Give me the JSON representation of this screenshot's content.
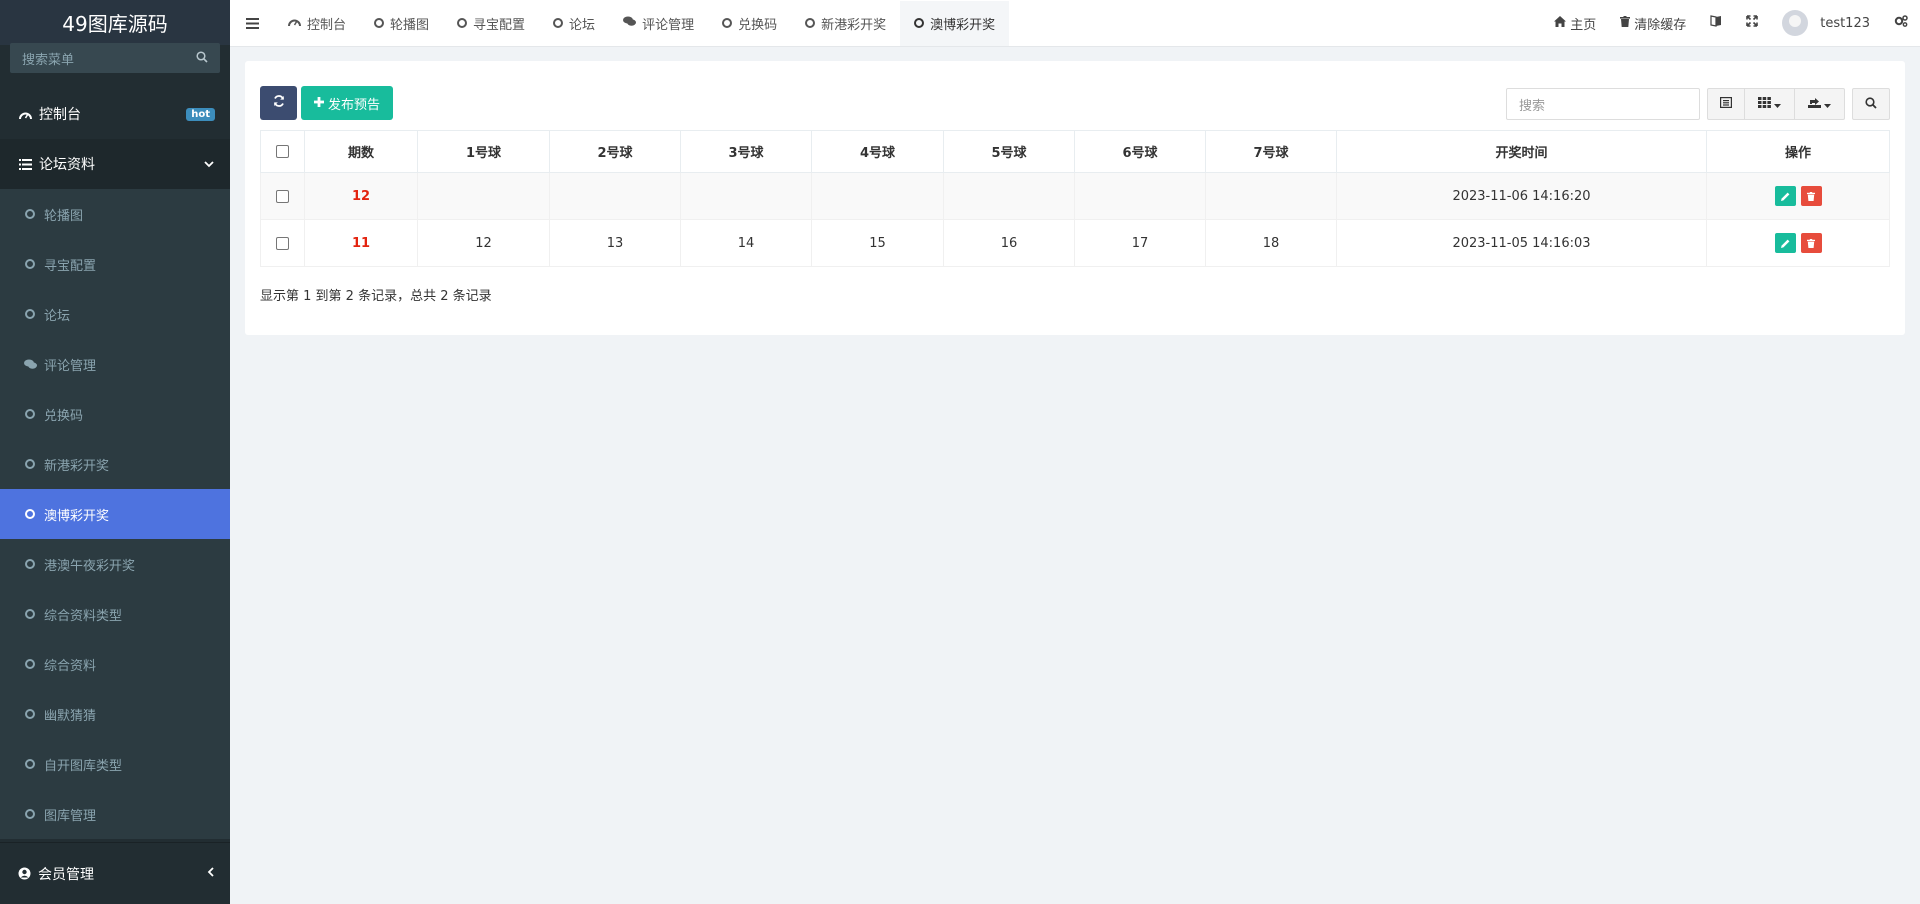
{
  "brand": "49图库源码",
  "sidebar": {
    "search_placeholder": "搜索菜单",
    "dashboard": {
      "label": "控制台",
      "badge": "hot"
    },
    "group": {
      "label": "论坛资料"
    },
    "items": [
      {
        "label": "轮播图"
      },
      {
        "label": "寻宝配置"
      },
      {
        "label": "论坛"
      },
      {
        "label": "评论管理"
      },
      {
        "label": "兑换码"
      },
      {
        "label": "新港彩开奖"
      },
      {
        "label": "澳博彩开奖"
      },
      {
        "label": "港澳午夜彩开奖"
      },
      {
        "label": "综合资料类型"
      },
      {
        "label": "综合资料"
      },
      {
        "label": "幽默猜猜"
      },
      {
        "label": "自开图库类型"
      },
      {
        "label": "图库管理"
      }
    ],
    "member": {
      "label": "会员管理"
    }
  },
  "topbar": {
    "tabs": [
      {
        "label": "控制台"
      },
      {
        "label": "轮播图"
      },
      {
        "label": "寻宝配置"
      },
      {
        "label": "论坛"
      },
      {
        "label": "评论管理"
      },
      {
        "label": "兑换码"
      },
      {
        "label": "新港彩开奖"
      },
      {
        "label": "澳博彩开奖"
      }
    ],
    "home": "主页",
    "clear_cache": "清除缓存",
    "username": "test123"
  },
  "toolbar": {
    "add_label": "发布预告",
    "search_placeholder": "搜索"
  },
  "table": {
    "headers": [
      "期数",
      "1号球",
      "2号球",
      "3号球",
      "4号球",
      "5号球",
      "6号球",
      "7号球",
      "开奖时间",
      "操作"
    ],
    "rows": [
      {
        "issue": "12",
        "b1": "",
        "b2": "",
        "b3": "",
        "b4": "",
        "b5": "",
        "b6": "",
        "b7": "",
        "time": "2023-11-06 14:16:20"
      },
      {
        "issue": "11",
        "b1": "12",
        "b2": "13",
        "b3": "14",
        "b4": "15",
        "b5": "16",
        "b6": "17",
        "b7": "18",
        "time": "2023-11-05 14:16:03"
      }
    ]
  },
  "summary": "显示第 1 到第 2 条记录，总共 2 条记录",
  "colors": {
    "accent": "#4e73df",
    "success": "#18bc9c",
    "danger": "#e74c3c",
    "primary_dark": "#3c4c70",
    "issue_red": "#e3230f"
  }
}
